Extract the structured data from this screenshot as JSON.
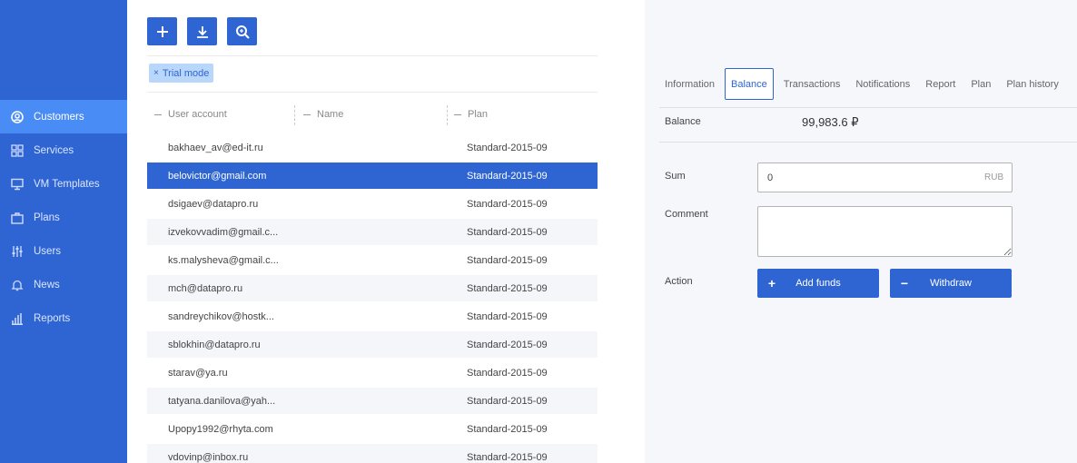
{
  "sidebar": {
    "items": [
      {
        "label": "Customers",
        "icon": "user-circle-icon",
        "active": true
      },
      {
        "label": "Services",
        "icon": "grid-icon",
        "active": false
      },
      {
        "label": "VM Templates",
        "icon": "monitor-icon",
        "active": false
      },
      {
        "label": "Plans",
        "icon": "briefcase-icon",
        "active": false
      },
      {
        "label": "Users",
        "icon": "sliders-icon",
        "active": false
      },
      {
        "label": "News",
        "icon": "bell-icon",
        "active": false
      },
      {
        "label": "Reports",
        "icon": "bar-chart-icon",
        "active": false
      }
    ]
  },
  "toolbar": {
    "buttons": [
      "plus-icon",
      "download-icon",
      "zoom-search-icon"
    ]
  },
  "filter": {
    "label": "Trial mode",
    "remove": "×"
  },
  "table": {
    "columns": [
      "User account",
      "Name",
      "Plan"
    ],
    "rows": [
      {
        "account": "bakhaev_av@ed-it.ru",
        "name": "",
        "plan": "Standard-2015-09"
      },
      {
        "account": "belovictor@gmail.com",
        "name": "",
        "plan": "Standard-2015-09",
        "selected": true
      },
      {
        "account": "dsigaev@datapro.ru",
        "name": "",
        "plan": "Standard-2015-09"
      },
      {
        "account": "izvekovvadim@gmail.c...",
        "name": "",
        "plan": "Standard-2015-09"
      },
      {
        "account": "ks.malysheva@gmail.c...",
        "name": "",
        "plan": "Standard-2015-09"
      },
      {
        "account": "mch@datapro.ru",
        "name": "",
        "plan": "Standard-2015-09"
      },
      {
        "account": "sandreychikov@hostk...",
        "name": "",
        "plan": "Standard-2015-09"
      },
      {
        "account": "sblokhin@datapro.ru",
        "name": "",
        "plan": "Standard-2015-09"
      },
      {
        "account": "starav@ya.ru",
        "name": "",
        "plan": "Standard-2015-09"
      },
      {
        "account": "tatyana.danilova@yah...",
        "name": "",
        "plan": "Standard-2015-09"
      },
      {
        "account": "Upopy1992@rhyta.com",
        "name": "",
        "plan": "Standard-2015-09"
      },
      {
        "account": "vdovinp@inbox.ru",
        "name": "",
        "plan": "Standard-2015-09"
      }
    ]
  },
  "panel": {
    "tabs": [
      {
        "label": "Information",
        "active": false
      },
      {
        "label": "Balance",
        "active": true
      },
      {
        "label": "Transactions",
        "active": false
      },
      {
        "label": "Notifications",
        "active": false
      },
      {
        "label": "Report",
        "active": false
      },
      {
        "label": "Plan",
        "active": false
      },
      {
        "label": "Plan history",
        "active": false
      }
    ],
    "balance_label": "Balance",
    "balance_value": "99,983.6 ₽",
    "sum_label": "Sum",
    "sum_value": "0",
    "sum_unit": "RUB",
    "comment_label": "Comment",
    "comment_value": "",
    "action_label": "Action",
    "add_funds": {
      "symbol": "+",
      "label": "Add funds"
    },
    "withdraw": {
      "symbol": "−",
      "label": "Withdraw"
    }
  },
  "colors": {
    "primary": "#2f65d2",
    "sidebar_active": "#4a8cf5",
    "chip_bg": "#b9d6fb",
    "panel_bg": "#f6f7fb",
    "row_alt": "#f4f6fa"
  }
}
